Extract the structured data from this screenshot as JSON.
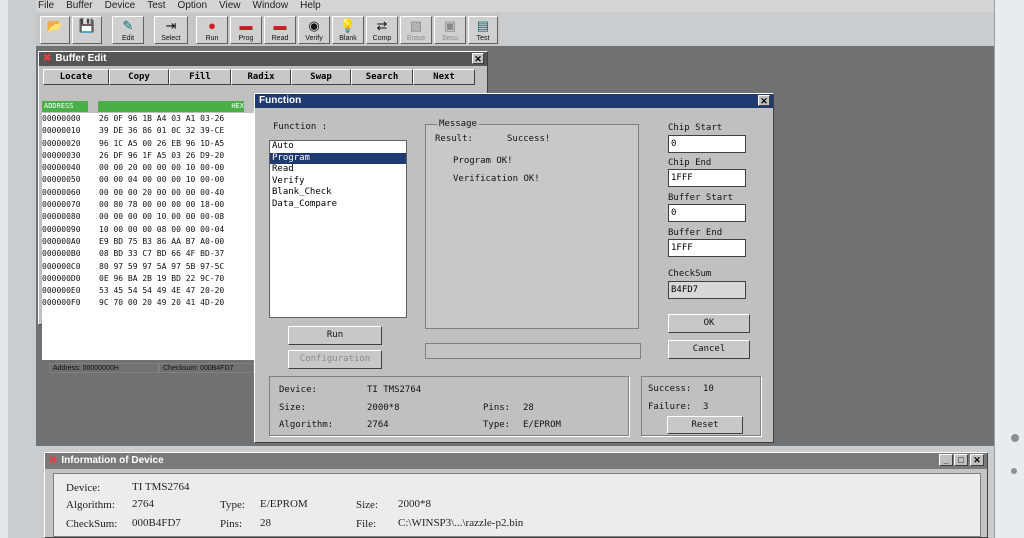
{
  "menu": [
    "File",
    "Buffer",
    "Device",
    "Test",
    "Option",
    "View",
    "Window",
    "Help"
  ],
  "toolbar": [
    {
      "label": "",
      "icon": "open-folder-icon",
      "glyph": "📂"
    },
    {
      "label": "",
      "icon": "save-icon",
      "glyph": "💾"
    },
    {
      "label": "Edit",
      "icon": "edit-icon",
      "glyph": "✎"
    },
    {
      "label": "Select",
      "icon": "select-icon",
      "glyph": "⇥"
    },
    {
      "label": "Run",
      "icon": "run-icon",
      "glyph": "●"
    },
    {
      "label": "Prog",
      "icon": "program-icon",
      "glyph": "▬"
    },
    {
      "label": "Read",
      "icon": "read-icon",
      "glyph": "▬"
    },
    {
      "label": "Verify",
      "icon": "verify-icon",
      "glyph": "◉"
    },
    {
      "label": "Blank",
      "icon": "blank-icon",
      "glyph": "💡"
    },
    {
      "label": "Comp",
      "icon": "compare-icon",
      "glyph": "⇄"
    },
    {
      "label": "Erase",
      "icon": "erase-icon",
      "glyph": "▧"
    },
    {
      "label": "Secu",
      "icon": "security-icon",
      "glyph": "▣"
    },
    {
      "label": "Test",
      "icon": "test-icon",
      "glyph": "▤"
    }
  ],
  "buffer": {
    "title": "Buffer Edit",
    "buttons": [
      "Locate",
      "Copy",
      "Fill",
      "Radix",
      "Swap",
      "Search",
      "Next"
    ],
    "address_header": "ADDRESS",
    "hex_header": "HEX",
    "rows": [
      {
        "addr": "00000000",
        "hex": "26 0F 96 1B A4 03 A1 03-26"
      },
      {
        "addr": "00000010",
        "hex": "39 DE 36 86 01 0C 32 39-CE"
      },
      {
        "addr": "00000020",
        "hex": "96 1C A5 00 26 EB 96 1D-A5"
      },
      {
        "addr": "00000030",
        "hex": "26 DF 96 1F A5 03 26 D9-20"
      },
      {
        "addr": "00000040",
        "hex": "00 00 20 00 00 00 10 00-00"
      },
      {
        "addr": "00000050",
        "hex": "00 00 04 00 00 00 10 00-00"
      },
      {
        "addr": "00000060",
        "hex": "00 00 00 20 00 00 00 00-40"
      },
      {
        "addr": "00000070",
        "hex": "00 80 78 00 00 00 00 18-00"
      },
      {
        "addr": "00000080",
        "hex": "00 00 00 00 10 00 00 00-08"
      },
      {
        "addr": "00000090",
        "hex": "10 00 00 00 08 00 00 00-04"
      },
      {
        "addr": "000000A0",
        "hex": "E9 BD 75 B3 86 AA B7 A0-00"
      },
      {
        "addr": "000000B0",
        "hex": "08 BD 33 C7 BD 66 4F BD-37"
      },
      {
        "addr": "000000C0",
        "hex": "80 97 59 97 5A 97 5B 97-5C"
      },
      {
        "addr": "000000D0",
        "hex": "0E 96 BA 2B 19 BD 22 9C-70"
      },
      {
        "addr": "000000E0",
        "hex": "53 45 54 54 49 4E 47 20-20"
      },
      {
        "addr": "000000F0",
        "hex": "9C 70 00 20 49 20 41 4D-20"
      }
    ],
    "status_address": "Address: 00000000H",
    "status_checksum": "Checksum: 000B4FD7"
  },
  "function_dialog": {
    "title": "Function",
    "function_label": "Function :",
    "functions": [
      "Auto",
      "Program",
      "Read",
      "Verify",
      "Blank_Check",
      "Data_Compare"
    ],
    "selected_function": "Program",
    "message_label": "Message",
    "result_label": "Result:",
    "result_value": "Success!",
    "messages": [
      "Program OK!",
      "Verification OK!"
    ],
    "chip_start_label": "Chip Start",
    "chip_start": "0",
    "chip_end_label": "Chip End",
    "chip_end": "1FFF",
    "buffer_start_label": "Buffer Start",
    "buffer_start": "0",
    "buffer_end_label": "Buffer End",
    "buffer_end": "1FFF",
    "checksum_label": "CheckSum",
    "checksum": "B4FD7",
    "run_label": "Run",
    "configuration_label": "Configuration",
    "ok_label": "OK",
    "cancel_label": "Cancel",
    "device_label": "Device:",
    "device": "TI TMS2764",
    "size_label": "Size:",
    "size": "2000*8",
    "pins_label": "Pins:",
    "pins": "28",
    "algorithm_label": "Algorithm:",
    "algorithm": "2764",
    "type_label": "Type:",
    "type": "E/EPROM",
    "success_label": "Success:",
    "success": "10",
    "failure_label": "Failure:",
    "failure": "3",
    "reset_label": "Reset"
  },
  "info_window": {
    "title": "Information of Device",
    "device_label": "Device:",
    "device": "TI TMS2764",
    "algorithm_label": "Algorithm:",
    "algorithm": "2764",
    "type_label": "Type:",
    "type": "E/EPROM",
    "size_label": "Size:",
    "size": "2000*8",
    "checksum_label": "CheckSum:",
    "checksum": "000B4FD7",
    "pins_label": "Pins:",
    "pins": "28",
    "file_label": "File:",
    "file": "C:\\WINSP3\\...\\razzle-p2.bin"
  },
  "colors": {
    "dialog_title": "#1f3a73",
    "buffer_header": "#49b047",
    "workspace": "#6f7173"
  }
}
